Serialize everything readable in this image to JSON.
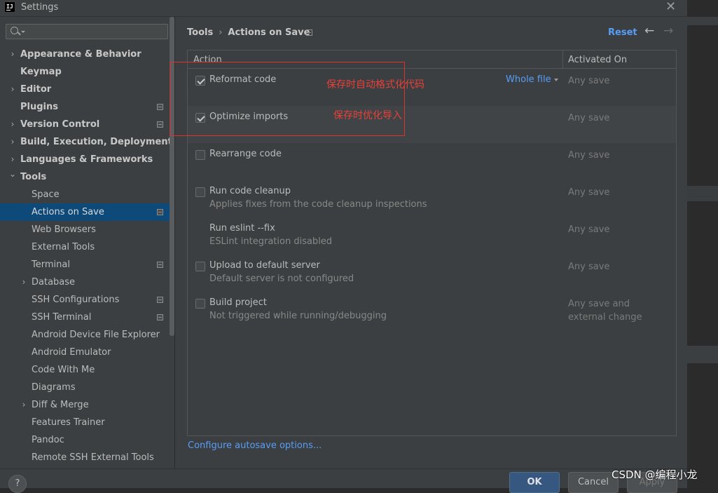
{
  "window": {
    "title": "Settings"
  },
  "search": {
    "placeholder": ""
  },
  "sidebar": {
    "items": [
      {
        "label": "Appearance & Behavior",
        "bold": true,
        "expandable": true,
        "expanded": false,
        "indent": 0,
        "project": false
      },
      {
        "label": "Keymap",
        "bold": true,
        "expandable": false,
        "indent": 0,
        "project": false
      },
      {
        "label": "Editor",
        "bold": true,
        "expandable": true,
        "expanded": false,
        "indent": 0,
        "project": false
      },
      {
        "label": "Plugins",
        "bold": true,
        "expandable": false,
        "indent": 0,
        "project": true
      },
      {
        "label": "Version Control",
        "bold": true,
        "expandable": true,
        "expanded": false,
        "indent": 0,
        "project": true
      },
      {
        "label": "Build, Execution, Deployment",
        "bold": true,
        "expandable": true,
        "expanded": false,
        "indent": 0,
        "project": false
      },
      {
        "label": "Languages & Frameworks",
        "bold": true,
        "expandable": true,
        "expanded": false,
        "indent": 0,
        "project": false
      },
      {
        "label": "Tools",
        "bold": true,
        "expandable": true,
        "expanded": true,
        "indent": 0,
        "project": false
      },
      {
        "label": "Space",
        "bold": false,
        "expandable": false,
        "indent": 1,
        "project": false
      },
      {
        "label": "Actions on Save",
        "bold": false,
        "expandable": false,
        "indent": 1,
        "project": true,
        "selected": true
      },
      {
        "label": "Web Browsers",
        "bold": false,
        "expandable": false,
        "indent": 1,
        "project": false
      },
      {
        "label": "External Tools",
        "bold": false,
        "expandable": false,
        "indent": 1,
        "project": false
      },
      {
        "label": "Terminal",
        "bold": false,
        "expandable": false,
        "indent": 1,
        "project": true
      },
      {
        "label": "Database",
        "bold": false,
        "expandable": true,
        "expanded": false,
        "indent": 1,
        "project": false
      },
      {
        "label": "SSH Configurations",
        "bold": false,
        "expandable": false,
        "indent": 1,
        "project": true
      },
      {
        "label": "SSH Terminal",
        "bold": false,
        "expandable": false,
        "indent": 1,
        "project": true
      },
      {
        "label": "Android Device File Explorer",
        "bold": false,
        "expandable": false,
        "indent": 1,
        "project": false
      },
      {
        "label": "Android Emulator",
        "bold": false,
        "expandable": false,
        "indent": 1,
        "project": false
      },
      {
        "label": "Code With Me",
        "bold": false,
        "expandable": false,
        "indent": 1,
        "project": false
      },
      {
        "label": "Diagrams",
        "bold": false,
        "expandable": false,
        "indent": 1,
        "project": false
      },
      {
        "label": "Diff & Merge",
        "bold": false,
        "expandable": true,
        "expanded": false,
        "indent": 1,
        "project": false
      },
      {
        "label": "Features Trainer",
        "bold": false,
        "expandable": false,
        "indent": 1,
        "project": false
      },
      {
        "label": "Pandoc",
        "bold": false,
        "expandable": false,
        "indent": 1,
        "project": false
      },
      {
        "label": "Remote SSH External Tools",
        "bold": false,
        "expandable": false,
        "indent": 1,
        "project": false
      }
    ]
  },
  "breadcrumb": {
    "parent": "Tools",
    "current": "Actions on Save"
  },
  "header": {
    "reset": "Reset",
    "back_icon": "←",
    "forward_icon": "→"
  },
  "table": {
    "columns": [
      "Action",
      "Activated On"
    ],
    "rows": [
      {
        "name": "Reformat code",
        "description": "",
        "checkbox": true,
        "checked": true,
        "activated_on": "Any save",
        "option": "Whole file"
      },
      {
        "name": "Optimize imports",
        "description": "",
        "checkbox": true,
        "checked": true,
        "activated_on": "Any save",
        "highlighted": true
      },
      {
        "name": "Rearrange code",
        "description": "",
        "checkbox": true,
        "checked": false,
        "activated_on": "Any save"
      },
      {
        "name": "Run code cleanup",
        "description": "Applies fixes from the code cleanup inspections",
        "checkbox": true,
        "checked": false,
        "activated_on": "Any save"
      },
      {
        "name": "Run eslint --fix",
        "description": "ESLint integration disabled",
        "checkbox": false,
        "checked": false,
        "activated_on": "Any save"
      },
      {
        "name": "Upload to default server",
        "description": "Default server is not configured",
        "checkbox": true,
        "checked": false,
        "activated_on": "Any save"
      },
      {
        "name": "Build project",
        "description": "Not triggered while running/debugging",
        "checkbox": true,
        "checked": false,
        "activated_on": "Any save and external change",
        "activated_lines": [
          "Any save and",
          "external change"
        ]
      }
    ]
  },
  "configure_link": "Configure autosave options...",
  "annotations": {
    "reformat_note": "保存时自动格式化代码",
    "optimize_note": "保存时优化导入"
  },
  "footer": {
    "help": "?",
    "ok": "OK",
    "cancel": "Cancel",
    "apply": "Apply"
  },
  "watermark": "CSDN @编程小龙",
  "colors": {
    "accent": "#589df6",
    "selection": "#0d4a7a",
    "annotation": "#e8413a",
    "background": "#3c3f41"
  }
}
